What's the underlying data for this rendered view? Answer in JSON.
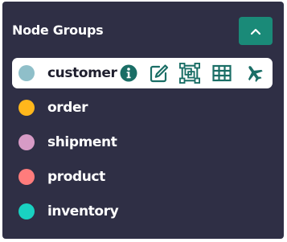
{
  "panel": {
    "title": "Node Groups",
    "collapse_icon": "chevron-up-icon"
  },
  "groups": [
    {
      "label": "customer",
      "color": "#8fbfc9",
      "selected": true
    },
    {
      "label": "order",
      "color": "#ffb71c",
      "selected": false
    },
    {
      "label": "shipment",
      "color": "#d79bc6",
      "selected": false
    },
    {
      "label": "product",
      "color": "#ff7c7c",
      "selected": false
    },
    {
      "label": "inventory",
      "color": "#19d1c1",
      "selected": false
    }
  ],
  "row_actions": [
    {
      "icon": "info-icon"
    },
    {
      "icon": "edit-icon"
    },
    {
      "icon": "select-area-icon"
    },
    {
      "icon": "table-icon"
    },
    {
      "icon": "airplane-icon"
    }
  ],
  "colors": {
    "panel_bg": "#2f2f45",
    "accent": "#1a8a78",
    "icon_color": "#1a6e66"
  }
}
